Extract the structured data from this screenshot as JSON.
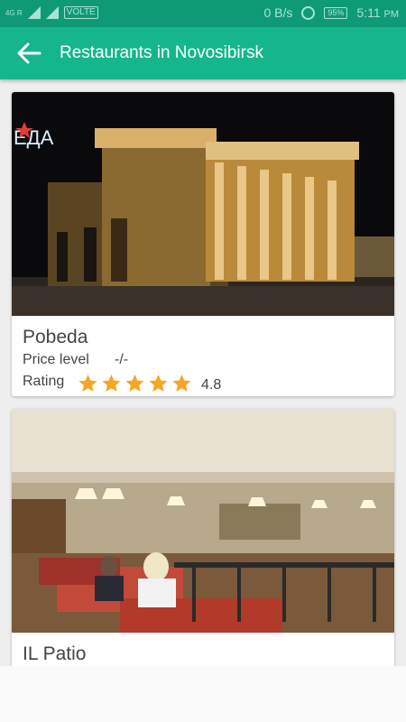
{
  "status_bar": {
    "network_left": "4G R",
    "volte": "VOLTE",
    "speed": "0 B/s",
    "battery": "95%",
    "time": "5:11",
    "ampm": "PM"
  },
  "app_bar": {
    "title": "Restaurants in Novosibirsk"
  },
  "restaurants": [
    {
      "name": "Pobeda",
      "price_label": "Price level",
      "price_value": "-/-",
      "rating_label": "Rating",
      "rating_value": "4.8",
      "rating_stars": 5,
      "sign_text": "ЕДА"
    },
    {
      "name": "IL Patio"
    }
  ],
  "colors": {
    "primary": "#16b68c",
    "status": "#0f9a76",
    "star": "#f5a623"
  }
}
